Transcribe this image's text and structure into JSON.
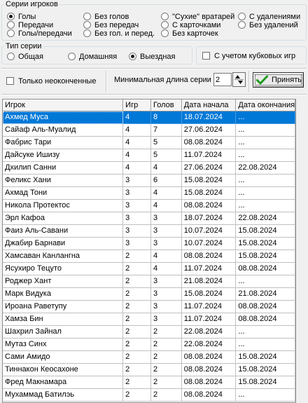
{
  "series_group": {
    "legend": "Серии игроков",
    "options": [
      {
        "label": "Голы",
        "selected": true
      },
      {
        "label": "Передачи",
        "selected": false
      },
      {
        "label": "Голы/передачи",
        "selected": false
      },
      {
        "label": "Без голов",
        "selected": false
      },
      {
        "label": "Без передач",
        "selected": false
      },
      {
        "label": "Без гол. и перед.",
        "selected": false
      },
      {
        "label": "\"Сухие\" вратарей",
        "selected": false
      },
      {
        "label": "С карточками",
        "selected": false
      },
      {
        "label": "Без карточек",
        "selected": false
      },
      {
        "label": "С удалениями",
        "selected": false
      },
      {
        "label": "Без удалений",
        "selected": false
      }
    ]
  },
  "type_group": {
    "legend": "Тип серии",
    "options": [
      {
        "label": "Общая",
        "selected": false
      },
      {
        "label": "Домашняя",
        "selected": false
      },
      {
        "label": "Выездная",
        "selected": true
      }
    ],
    "cup_label": "С учетом кубковых игр",
    "cup_checked": false
  },
  "toolbar": {
    "unfinished_label": "Только неоконченные",
    "unfinished_checked": false,
    "min_length_label": "Минимальная длина серии",
    "min_length_value": "2",
    "accept_label": "Принять"
  },
  "table": {
    "columns": [
      "Игрок",
      "Игр",
      "Голов",
      "Дата начала",
      "Дата окончания"
    ],
    "selected_row": 0,
    "rows": [
      [
        "Ахмед Муса",
        "4",
        "8",
        "18.07.2024",
        "..."
      ],
      [
        "Сайаф Аль-Муалид",
        "4",
        "7",
        "27.06.2024",
        "..."
      ],
      [
        "Фабрис Тари",
        "4",
        "5",
        "08.08.2024",
        "..."
      ],
      [
        "Дайсуке Ишизу",
        "4",
        "5",
        "11.07.2024",
        "..."
      ],
      [
        "Дхилип Санни",
        "4",
        "4",
        "27.06.2024",
        "22.08.2024"
      ],
      [
        "Феликс Хани",
        "3",
        "6",
        "15.08.2024",
        "..."
      ],
      [
        "Ахмад Тони",
        "3",
        "4",
        "15.08.2024",
        "..."
      ],
      [
        "Никола Протектос",
        "3",
        "4",
        "08.08.2024",
        "..."
      ],
      [
        "Эрл Кафоа",
        "3",
        "3",
        "18.07.2024",
        "22.08.2024"
      ],
      [
        "Фаиз Аль-Савани",
        "3",
        "3",
        "10.07.2024",
        "15.08.2024"
      ],
      [
        "Джабир Барнави",
        "3",
        "3",
        "10.07.2024",
        "15.08.2024"
      ],
      [
        "Хамсаван Канлангна",
        "2",
        "4",
        "08.08.2024",
        "15.08.2024"
      ],
      [
        "Ясухиро Тецуто",
        "2",
        "4",
        "11.07.2024",
        "08.08.2024"
      ],
      [
        "Роджер Хант",
        "2",
        "3",
        "21.08.2024",
        "..."
      ],
      [
        "Марк Видука",
        "2",
        "3",
        "15.08.2024",
        "21.08.2024"
      ],
      [
        "Ироана Раветупу",
        "2",
        "3",
        "11.07.2024",
        "08.08.2024"
      ],
      [
        "Хамза Бин",
        "2",
        "3",
        "11.07.2024",
        "08.08.2024"
      ],
      [
        "Шахрил Зайнал",
        "2",
        "2",
        "22.08.2024",
        "..."
      ],
      [
        "Мутаз Синх",
        "2",
        "2",
        "22.08.2024",
        "..."
      ],
      [
        "Сами Амидо",
        "2",
        "2",
        "08.08.2024",
        "15.08.2024"
      ],
      [
        "Тиннакон Кеосахоне",
        "2",
        "2",
        "08.08.2024",
        "15.08.2024"
      ],
      [
        "Фред Макнамара",
        "2",
        "2",
        "08.08.2024",
        "15.08.2024"
      ],
      [
        "Мухаммад Батилэь",
        "2",
        "2",
        "08.08.2024",
        "..."
      ]
    ]
  }
}
